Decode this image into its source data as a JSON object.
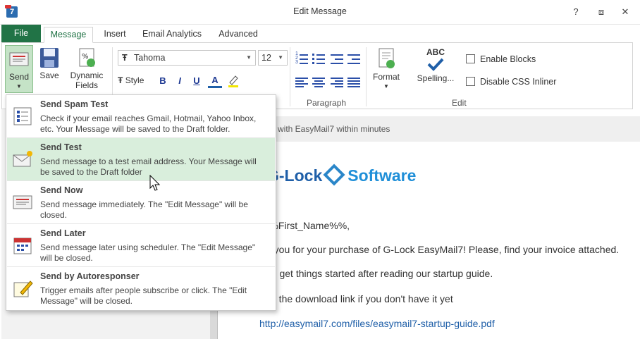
{
  "window": {
    "title": "Edit Message",
    "help": "?",
    "restore": "⧈",
    "close": "✕"
  },
  "tabs": {
    "file": "File",
    "items": [
      "Message",
      "Insert",
      "Email Analytics",
      "Advanced"
    ],
    "active": "Message"
  },
  "ribbon": {
    "send": "Send",
    "save": "Save",
    "dynamic_fields_1": "Dynamic",
    "dynamic_fields_2": "Fields",
    "font_name": "Tahoma",
    "font_size": "12",
    "style": "Style",
    "bold": "B",
    "italic": "I",
    "underline": "U",
    "font_color": "A",
    "paragraph_label": "Paragraph",
    "format": "Format",
    "spelling_abc": "ABC",
    "spelling": "Spelling...",
    "edit_label": "Edit",
    "enable_blocks": "Enable Blocks",
    "disable_css_inliner": "Disable CSS Inliner"
  },
  "send_menu": [
    {
      "title": "Send Spam Test",
      "desc": "Check if your email reaches Gmail, Hotmail, Yahoo Inbox, etc. Your Message will be saved to the Draft folder."
    },
    {
      "title": "Send Test",
      "desc": "Send message to a test email address. Your Message will be saved to the Draft folder"
    },
    {
      "title": "Send Now",
      "desc": "Send message immediately. The \"Edit Message\" will be closed."
    },
    {
      "title": "Send Later",
      "desc": "Send message later using scheduler.  The \"Edit Message\" will be closed."
    },
    {
      "title": "Send by Autoresponser",
      "desc": "Trigger emails after people subscribe or click. The \"Edit Message\" will be closed."
    }
  ],
  "editor": {
    "preheader": "with EasyMail7 within minutes",
    "logo_left": "G-Lock",
    "logo_right": "Software",
    "line1": "%%First_Name%%,",
    "line2": "nk you for your purchase of G-Lock EasyMail7! Please, find your invoice attached.",
    "line3": "can get things started after reading our startup guide.",
    "line4": "e is the download link if you don't have it yet",
    "link": "http://easymail7.com/files/easymail7-startup-guide.pdf"
  },
  "colors": {
    "accent": "#217346",
    "hover": "#d9eedc",
    "link": "#1f5fa8"
  }
}
